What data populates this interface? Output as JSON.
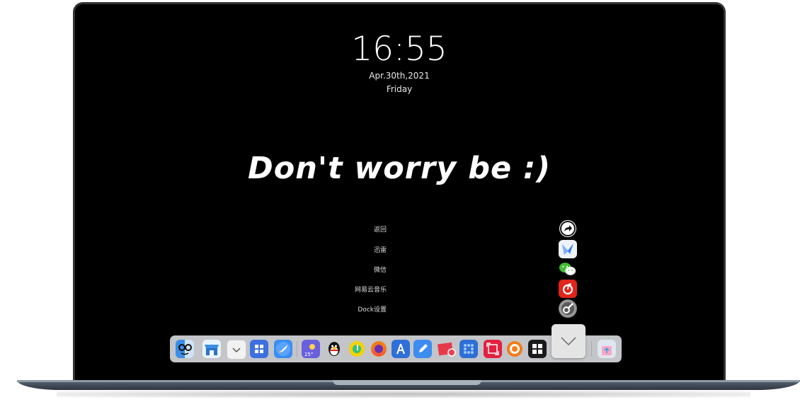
{
  "lockscreen": {
    "time": "16:55",
    "date": "Apr.30th,2021",
    "weekday": "Friday",
    "quote": "Don't worry be :)"
  },
  "dock_menu": {
    "items": [
      {
        "label": "返回",
        "icon": "share-arrow-icon"
      },
      {
        "label": "迅雷",
        "icon": "thunder-bird-icon"
      },
      {
        "label": "微信",
        "icon": "wechat-icon"
      },
      {
        "label": "网易云音乐",
        "icon": "netease-music-icon"
      },
      {
        "label": "Dock设置",
        "icon": "dock-settings-icon"
      }
    ]
  },
  "dock": {
    "apps": [
      "finder-icon",
      "store-icon",
      "dropdown-app-icon",
      "windows-start-icon",
      "rocket-launch-icon",
      "weather-icon",
      "qq-penguin-icon",
      "qq-music-icon",
      "firefox-icon",
      "app-store-icon",
      "pen-note-icon",
      "photo-icon",
      "grid-app-icon",
      "screenshot-icon",
      "dial-icon",
      "windows-terminal-icon",
      "recycle-bin-icon"
    ],
    "weather_temp": "25°"
  },
  "colors": {
    "screen": "#000000",
    "bezel": "#333333",
    "dock_bg": "#d2d4d8",
    "netease_red": "#e0251b",
    "wechat_green": "#3fbf2f",
    "firefox_orange": "#f57b17"
  }
}
